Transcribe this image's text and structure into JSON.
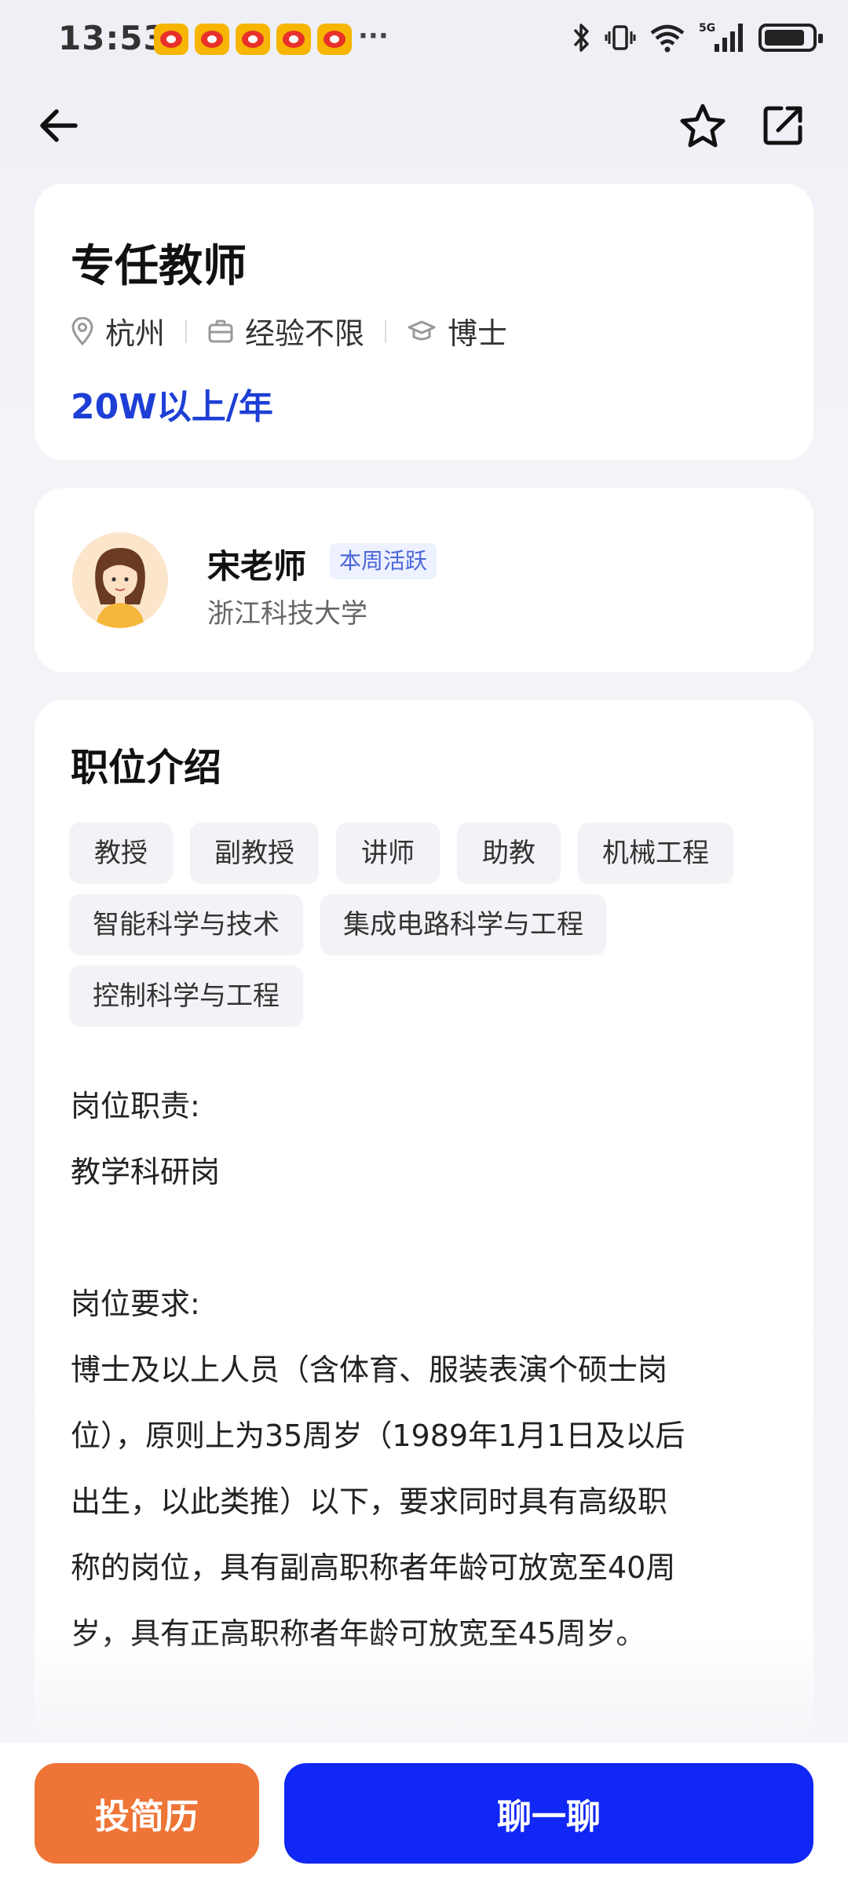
{
  "status_bar": {
    "time": "13:53",
    "more": "···",
    "icons": [
      "weibo-icon",
      "weibo-icon",
      "weibo-icon",
      "weibo-icon",
      "weibo-icon",
      "bluetooth-icon",
      "vibrate-icon",
      "wifi-icon",
      "signal-5g-icon",
      "battery-icon"
    ]
  },
  "nav": {
    "icons": [
      "back-arrow-icon",
      "star-icon",
      "share-icon"
    ]
  },
  "job": {
    "title": "专任教师",
    "location": "杭州",
    "experience": "经验不限",
    "education": "博士",
    "salary": "20W以上/年"
  },
  "recruiter": {
    "name": "宋老师",
    "badge": "本周活跃",
    "organization": "浙江科技大学"
  },
  "description": {
    "section_title": "职位介绍",
    "tags": [
      "教授",
      "副教授",
      "讲师",
      "助教",
      "机械工程",
      "智能科学与技术",
      "集成电路科学与工程",
      "控制科学与工程"
    ],
    "duty_heading": "岗位职责:",
    "duty_text": "教学科研岗",
    "req_heading": "岗位要求:",
    "req_lines": [
      "博士及以上人员（含体育、服装表演个硕士岗",
      "位），原则上为35周岁（1989年1月1日及以后",
      "出生，以此类推）以下，要求同时具有高级职",
      "称的岗位，具有副高职称者年龄可放宽至40周",
      "岁，具有正高职称者年龄可放宽至45周岁。"
    ]
  },
  "actions": {
    "apply_label": "投简历",
    "chat_label": "聊一聊"
  },
  "colors": {
    "salary": "#1d3fd6",
    "apply_button": "#ee7537",
    "chat_button": "#1027f5",
    "badge_text": "#4a66d8"
  }
}
